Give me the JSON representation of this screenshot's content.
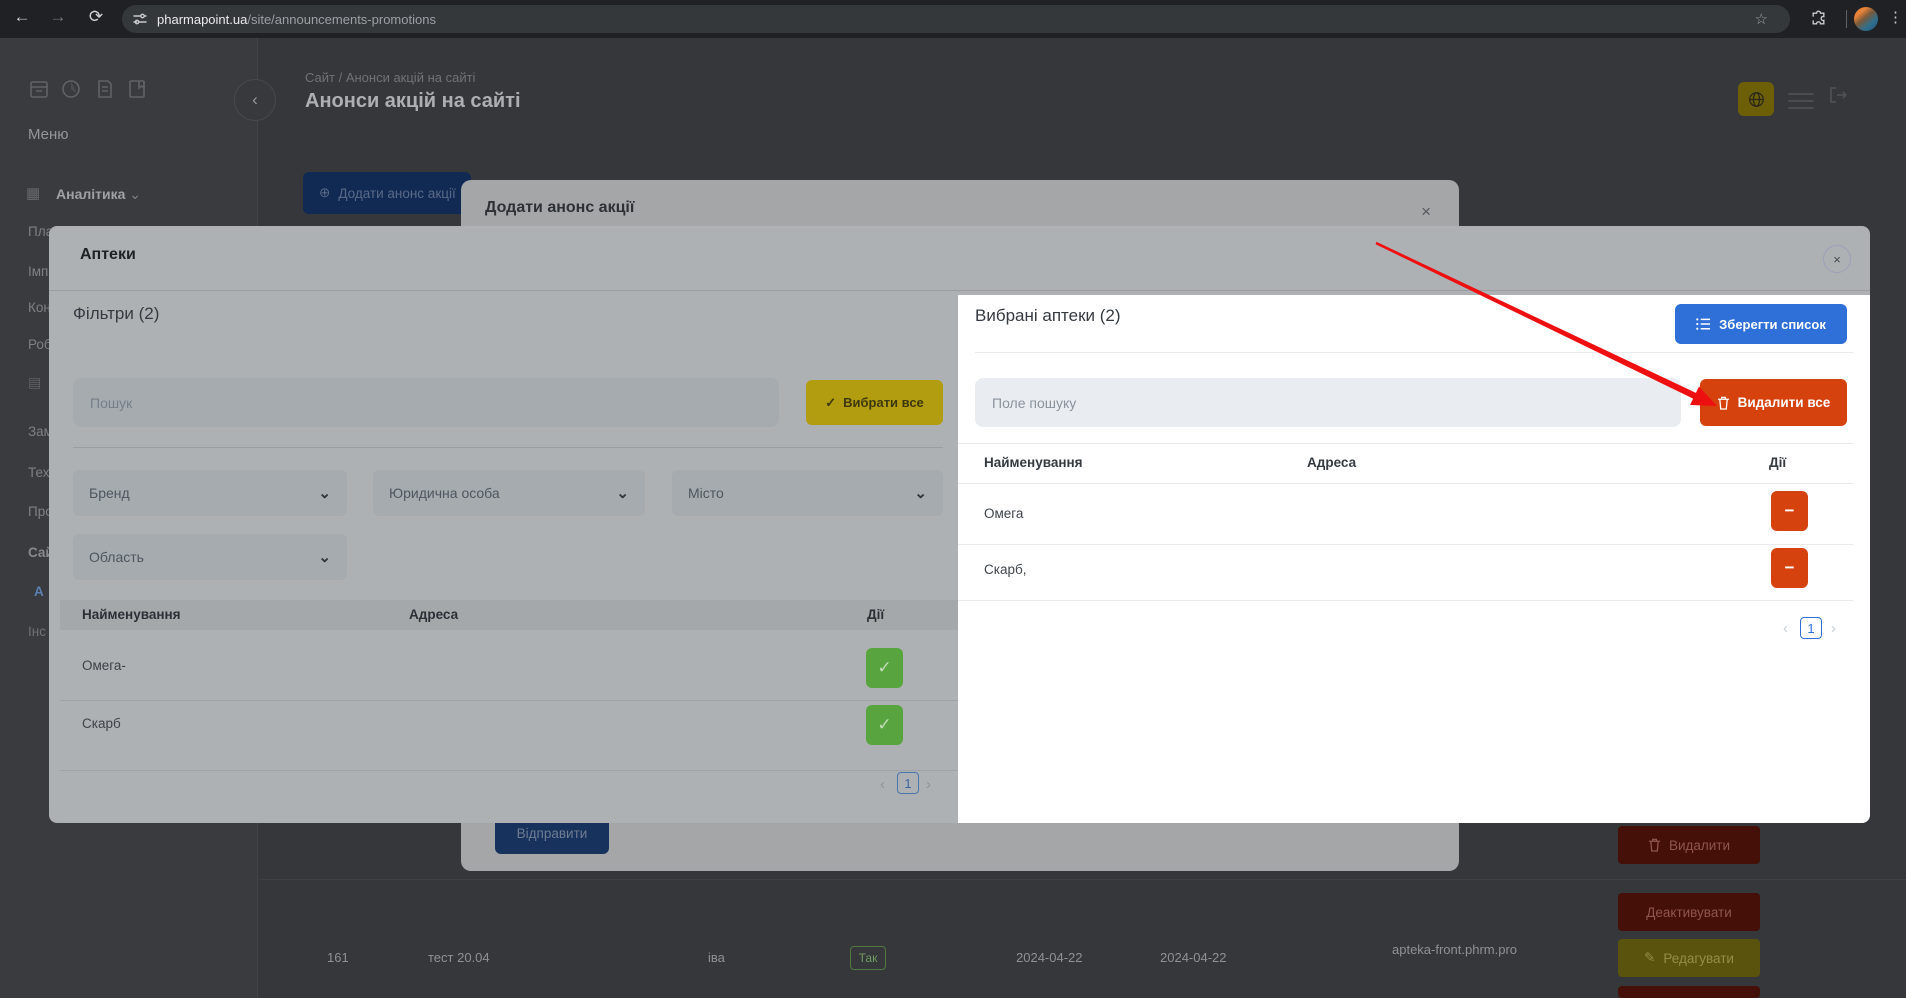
{
  "browser": {
    "url_domain": "pharmapoint.ua",
    "url_path": "/site/announcements-promotions"
  },
  "sidebar": {
    "menu": "Меню",
    "analytics": "Аналітика",
    "items": [
      "Пла",
      "Імп",
      "Кон",
      "Роб",
      "Зам",
      "Тех",
      "Про",
      "Сай",
      "А",
      "Інс"
    ]
  },
  "header": {
    "breadcrumb": "Сайт / Анонси акцій на сайті",
    "title": "Анонси акцій на сайті"
  },
  "page": {
    "add_button": "Додати анонс акції",
    "row": {
      "id": "161",
      "name": "тест 20.04",
      "user": "іва",
      "badge": "Так",
      "date1": "2024-04-22",
      "date2": "2024-04-22",
      "site": "apteka-front.phrm.pro"
    },
    "actions": {
      "delete": "Видалити",
      "deactivate": "Деактивувати",
      "edit": "Редагувати"
    }
  },
  "add_modal": {
    "title": "Додати анонс акції",
    "submit": "Відправити"
  },
  "pharmacies_modal": {
    "title": "Аптеки",
    "close": "×",
    "filters": {
      "heading": "Фільтри (2)",
      "search_placeholder": "Пошук",
      "select_all": "Вибрати все",
      "dropdowns": [
        "Бренд",
        "Юридична особа",
        "Місто",
        "Область"
      ],
      "headers": [
        "Найменування",
        "Адреса",
        "Дії"
      ],
      "rows": [
        "Омега-",
        "Скарб"
      ],
      "page": "1"
    },
    "selected": {
      "heading": "Вибрані аптеки (2)",
      "save": "Зберегти список",
      "search_placeholder": "Поле пошуку",
      "delete_all": "Видалити все",
      "headers": [
        "Найменування",
        "Адреса",
        "Дії"
      ],
      "rows": [
        "Омега",
        "Скарб,"
      ],
      "page": "1"
    }
  },
  "colors": {
    "accent_blue": "#2e6fd8",
    "danger_red": "#d5420d",
    "select_yellow": "#d4b106",
    "success_green": "#52c41a",
    "arrow_red": "#ee1010"
  }
}
